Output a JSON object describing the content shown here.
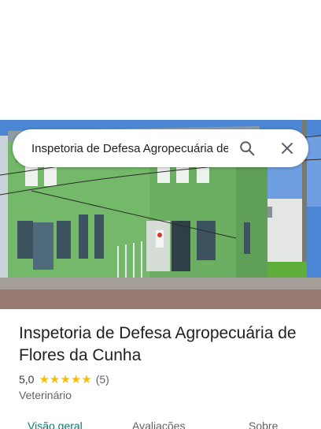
{
  "search": {
    "query": "Inspetoria de Defesa Agropecuária de Flores da Cunha"
  },
  "place": {
    "name": "Inspetoria de Defesa Agropecuária de Flores da Cunha",
    "rating": "5,0",
    "stars": 5,
    "review_count": "(5)",
    "category": "Veterinário"
  },
  "tabs": [
    {
      "label": "Visão geral",
      "active": true
    },
    {
      "label": "Avaliações",
      "active": false
    },
    {
      "label": "Sobre",
      "active": false
    }
  ],
  "colors": {
    "accent": "#0b7a75",
    "star": "#fbbc04",
    "building": "#6fb465"
  }
}
